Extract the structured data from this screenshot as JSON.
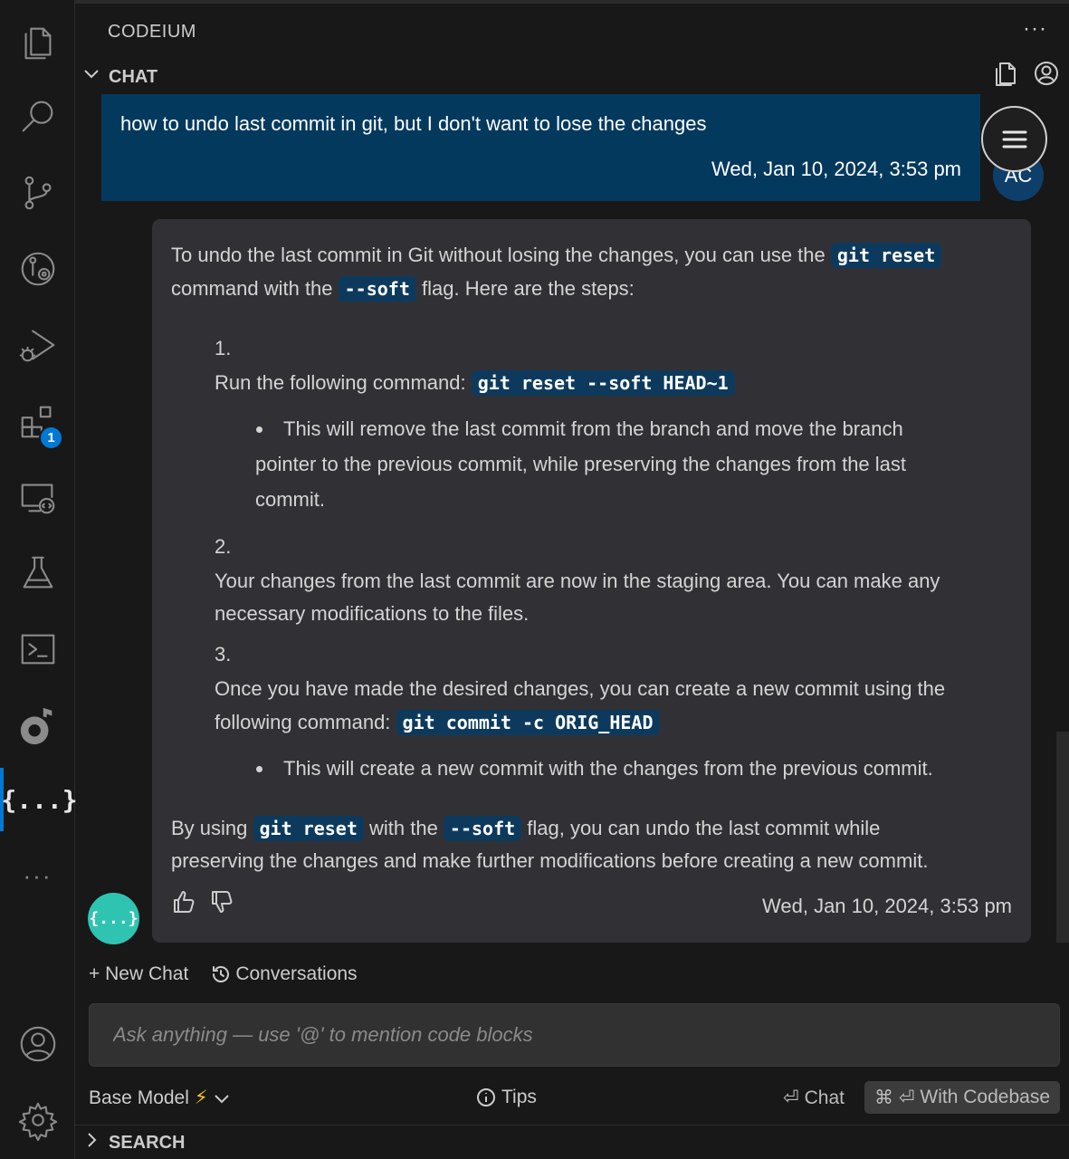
{
  "panel": {
    "title": "CODEIUM",
    "more": "···"
  },
  "chat_section": {
    "label": "CHAT",
    "chevron": "﹀"
  },
  "search_section": {
    "label": "SEARCH",
    "chevron": "〉"
  },
  "activity_bar": {
    "items": [
      "files-icon",
      "search-icon",
      "source-control-icon",
      "git-graph-icon",
      "run-debug-icon",
      "extensions-icon",
      "remote-explorer-icon",
      "testing-icon",
      "terminal-icon",
      "music-icon",
      "codeium-icon"
    ],
    "extensions_badge": "1",
    "codeium_glyph": "{...}",
    "more": "···"
  },
  "user_message": {
    "text": "how to undo last commit in git, but I don't want to lose the changes",
    "time": "Wed, Jan 10, 2024, 3:53 pm",
    "avatar": "AC"
  },
  "bot_message": {
    "intro_1": "To undo the last commit in Git without losing the changes, you can use the ",
    "intro_code_1": "git reset",
    "intro_2": "command with the ",
    "intro_code_2": "--soft",
    "intro_3": " flag. Here are the steps:",
    "step1_num": "1.",
    "step1_text": "Run the following command: ",
    "step1_code": "git reset --soft HEAD~1",
    "step1_bullet_l1": "This will remove the last commit from the branch and move the branch",
    "step1_bullet_l2": "pointer to the previous commit, while preserving the changes from the last",
    "step1_bullet_l3": "commit.",
    "step2_num": "2.",
    "step2_l1": "Your changes from the last commit are now in the staging area. You can make any",
    "step2_l2": "necessary modifications to the files.",
    "step3_num": "3.",
    "step3_l1": "Once you have made the desired changes, you can create a new commit using the",
    "step3_l2": "following command: ",
    "step3_code": "git commit -c ORIG_HEAD",
    "step3_bullet": "This will create a new commit with the changes from the previous commit.",
    "outro_1": "By using ",
    "outro_code_1": "git reset",
    "outro_2": " with the ",
    "outro_code_2": "--soft",
    "outro_3": " flag, you can undo the last commit while",
    "outro_l2": "preserving the changes and make further modifications before creating a new commit.",
    "time": "Wed, Jan 10, 2024, 3:53 pm",
    "avatar": "{...}"
  },
  "actions": {
    "new_chat": "+ New Chat",
    "conversations": "Conversations"
  },
  "input": {
    "placeholder": "Ask anything — use '@' to mention code blocks",
    "value": ""
  },
  "footer": {
    "model": "Base Model",
    "model_bolt": "⚡",
    "tips": "Tips",
    "chat": "Chat",
    "chat_key": "⏎",
    "codebase": "With Codebase",
    "codebase_keys": "⌘ ⏎"
  },
  "colors": {
    "accent": "#0078d4",
    "user_bubble": "#04395e",
    "bot_bubble": "#313135",
    "code_bg": "#0d3a5c",
    "bot_avatar": "#2fc4b2"
  }
}
